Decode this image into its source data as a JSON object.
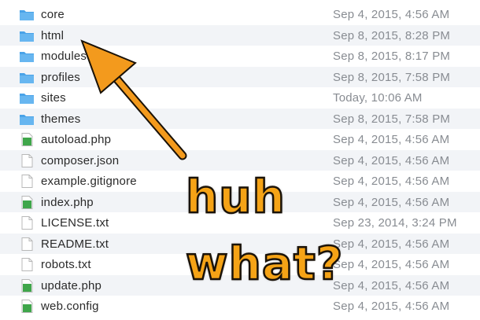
{
  "files": [
    {
      "name": "core",
      "date": "Sep 4, 2015, 4:56 AM",
      "icon": "folder-icon"
    },
    {
      "name": "html",
      "date": "Sep 8, 2015, 8:28 PM",
      "icon": "folder-icon"
    },
    {
      "name": "modules",
      "date": "Sep 8, 2015, 8:17 PM",
      "icon": "folder-icon"
    },
    {
      "name": "profiles",
      "date": "Sep 8, 2015, 7:58 PM",
      "icon": "folder-icon"
    },
    {
      "name": "sites",
      "date": "Today, 10:06 AM",
      "icon": "folder-icon"
    },
    {
      "name": "themes",
      "date": "Sep 8, 2015, 7:58 PM",
      "icon": "folder-icon"
    },
    {
      "name": "autoload.php",
      "date": "Sep 4, 2015, 4:56 AM",
      "icon": "php-file-icon"
    },
    {
      "name": "composer.json",
      "date": "Sep 4, 2015, 4:56 AM",
      "icon": "document-icon"
    },
    {
      "name": "example.gitignore",
      "date": "Sep 4, 2015, 4:56 AM",
      "icon": "document-icon"
    },
    {
      "name": "index.php",
      "date": "Sep 4, 2015, 4:56 AM",
      "icon": "php-file-icon"
    },
    {
      "name": "LICENSE.txt",
      "date": "Sep 23, 2014, 3:24 PM",
      "icon": "document-icon"
    },
    {
      "name": "README.txt",
      "date": "Sep 4, 2015, 4:56 AM",
      "icon": "document-icon"
    },
    {
      "name": "robots.txt",
      "date": "Sep 4, 2015, 4:56 AM",
      "icon": "document-icon"
    },
    {
      "name": "update.php",
      "date": "Sep 4, 2015, 4:56 AM",
      "icon": "php-file-icon"
    },
    {
      "name": "web.config",
      "date": "Sep 4, 2015, 4:56 AM",
      "icon": "php-file-icon"
    }
  ],
  "annotation": {
    "line1": "huh",
    "line2": "what?",
    "arrow_color": "#f39a1d",
    "text_color": "#f5a316"
  },
  "colors": {
    "folder": "#4aa3e8",
    "php": "#3fa64a",
    "alt_row": "#f2f4f7",
    "date_text": "#888c92"
  }
}
